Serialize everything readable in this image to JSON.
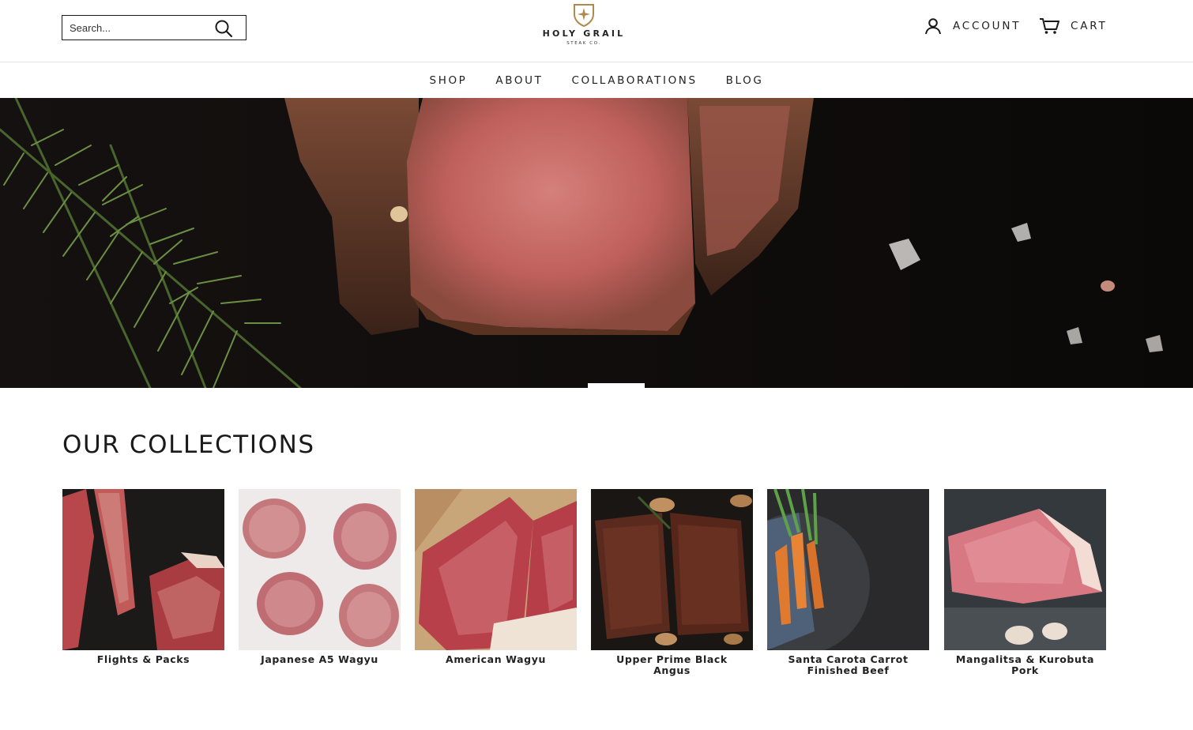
{
  "header": {
    "search": {
      "placeholder": "Search..."
    },
    "logo": {
      "name": "HOLY GRAIL",
      "sub": "STEAK CO."
    },
    "account_label": "ACCOUNT",
    "cart_label": "CART"
  },
  "nav": {
    "items": [
      {
        "label": "SHOP"
      },
      {
        "label": "ABOUT"
      },
      {
        "label": "COLLABORATIONS"
      },
      {
        "label": "BLOG"
      }
    ]
  },
  "hero": {
    "slide_count_visible": 1
  },
  "collections": {
    "heading": "OUR COLLECTIONS",
    "items": [
      {
        "title": "Flights & Packs"
      },
      {
        "title": "Japanese A5 Wagyu"
      },
      {
        "title": "American Wagyu"
      },
      {
        "title": "Upper Prime Black Angus"
      },
      {
        "title": "Santa Carota Carrot Finished Beef"
      },
      {
        "title": "Mangalitsa & Kurobuta Pork"
      }
    ]
  },
  "colors": {
    "text": "#1a1a1a",
    "logo_gold": "#b08a4a",
    "hero_bg": "#0e0b0a",
    "meat_red": "#c4625f"
  }
}
